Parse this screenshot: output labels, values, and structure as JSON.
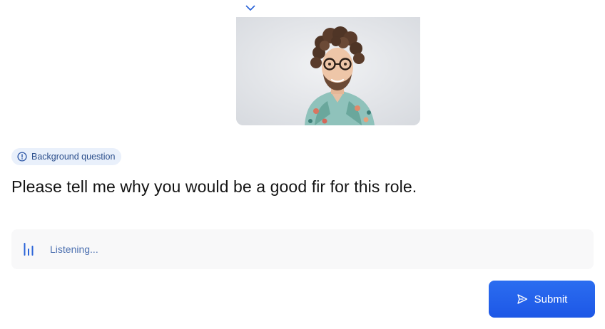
{
  "collapse_toggle": {
    "icon": "chevron-down-icon"
  },
  "video": {
    "icon": "participant-video"
  },
  "question": {
    "badge_icon": "info-circle-icon",
    "badge_label": "Background question",
    "text": "Please tell me why you would be a good fir for this role."
  },
  "answer": {
    "icon": "audio-bars-icon",
    "status": "Listening..."
  },
  "submit": {
    "icon": "send-icon",
    "label": "Submit"
  },
  "colors": {
    "accent": "#1d5ae8",
    "badge_bg": "#e9f0fb",
    "panel_bg": "#f8f8f9",
    "status_text": "#4c70b0"
  }
}
